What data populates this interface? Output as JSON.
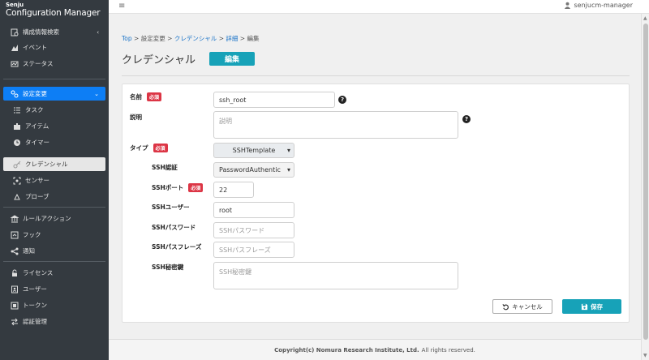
{
  "app": {
    "logo_line1": "Senju",
    "logo_line2": "Configuration Manager"
  },
  "topbar": {
    "username": "senjucm-manager"
  },
  "sidebar": {
    "items": [
      {
        "label": "構成情報検索",
        "icon": "search-db-icon"
      },
      {
        "label": "イベント",
        "icon": "event-icon"
      },
      {
        "label": "ステータス",
        "icon": "status-icon"
      },
      {
        "label": "設定変更",
        "icon": "settings-change-icon"
      },
      {
        "label": "タスク",
        "icon": "task-icon"
      },
      {
        "label": "アイテム",
        "icon": "puzzle-icon"
      },
      {
        "label": "タイマー",
        "icon": "clock-icon"
      },
      {
        "label": "クレデンシャル",
        "icon": "key-icon"
      },
      {
        "label": "センサー",
        "icon": "sensor-icon"
      },
      {
        "label": "プローブ",
        "icon": "probe-icon"
      },
      {
        "label": "ルールアクション",
        "icon": "rule-icon"
      },
      {
        "label": "フック",
        "icon": "hook-icon"
      },
      {
        "label": "通知",
        "icon": "share-icon"
      },
      {
        "label": "ライセンス",
        "icon": "lock-icon"
      },
      {
        "label": "ユーザー",
        "icon": "user-book-icon"
      },
      {
        "label": "トークン",
        "icon": "token-icon"
      },
      {
        "label": "認証管理",
        "icon": "auth-icon"
      }
    ]
  },
  "breadcrumb": {
    "top": "Top",
    "sep": ">",
    "settings": "設定変更",
    "credential": "クレデンシャル",
    "detail": "詳細",
    "edit": "編集"
  },
  "page": {
    "title": "クレデンシャル",
    "mode": "編集"
  },
  "form": {
    "required_label": "必須",
    "name": {
      "label": "名前",
      "value": "ssh_root"
    },
    "description": {
      "label": "説明",
      "placeholder": "説明"
    },
    "type": {
      "label": "タイプ",
      "value": "SSHTemplate"
    },
    "ssh_auth": {
      "label": "SSH認証",
      "value": "PasswordAuthentic"
    },
    "ssh_port": {
      "label": "SSHポート",
      "value": "22"
    },
    "ssh_user": {
      "label": "SSHユーザー",
      "value": "root"
    },
    "ssh_password": {
      "label": "SSHパスワード",
      "placeholder": "SSHパスワード"
    },
    "ssh_passphrase": {
      "label": "SSHパスフレーズ",
      "placeholder": "SSHパスフレーズ"
    },
    "ssh_private_key": {
      "label": "SSH秘密鍵",
      "placeholder": "SSH秘密鍵"
    }
  },
  "buttons": {
    "cancel": "キャンセル",
    "save": "保存"
  },
  "footer": {
    "copyright": "Copyright(c) Nomura Research Institute, Ltd.",
    "rights": "All rights reserved."
  },
  "colors": {
    "accent": "#17a2b8",
    "active_nav": "#0d7ef5",
    "required": "#dc3545",
    "sidebar": "#343a40"
  }
}
